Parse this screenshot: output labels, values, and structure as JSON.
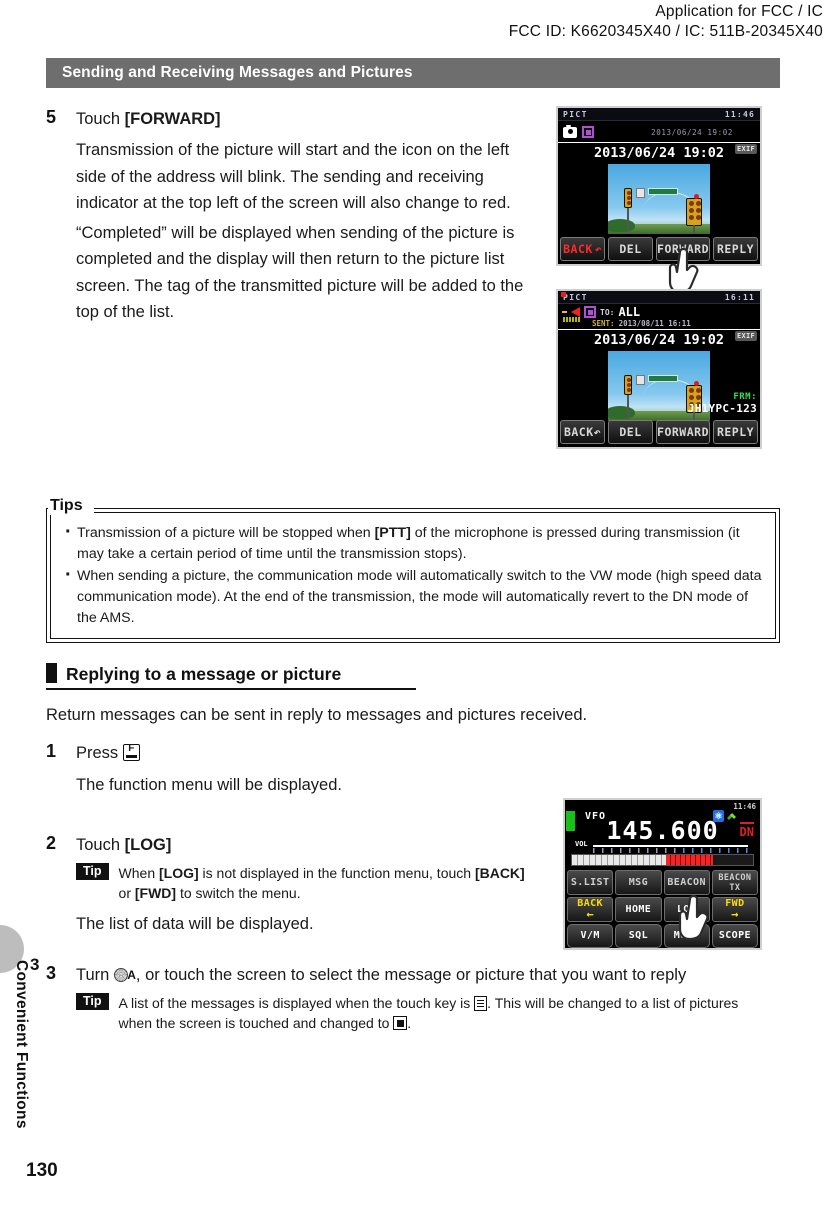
{
  "header": {
    "line1": "Application for FCC / IC",
    "line2": "FCC ID: K6620345X40 / IC: 511B-20345X40"
  },
  "sidebar": {
    "chapter_label": "Convenient Functions",
    "chapter_number": "3",
    "page_number": "130"
  },
  "section_bar": {
    "title": "Sending and Receiving Messages and Pictures"
  },
  "step5": {
    "number": "5",
    "head_prefix": "Touch ",
    "head_key": "[FORWARD]",
    "para1": "Transmission of the picture will start and the icon on the left side of the address will blink. The sending and receiving indicator at the top left of the screen will also change to red.",
    "para2": "“Completed” will be displayed when sending of the picture is completed and the display will then return to the picture list screen. The tag of the transmitted picture will be added to the top of the list."
  },
  "tips_box": {
    "title": "Tips",
    "items": [
      {
        "a": "Transmission of a picture will be stopped when ",
        "b": "[PTT]",
        "c": " of the microphone is pressed during transmission (it may take a certain period of time until the transmission stops)."
      },
      {
        "a": "When sending a picture, the communication mode will automatically switch to the VW mode (high speed data communication mode). At the end of the transmission, the mode will automatically revert to the DN mode of the AMS.",
        "b": "",
        "c": ""
      }
    ]
  },
  "subhead": {
    "title": "Replying to a message or picture"
  },
  "intro": {
    "text": "Return messages can be sent in reply to messages and pictures received."
  },
  "step1": {
    "number": "1",
    "head": "Press",
    "body": "The function menu will be displayed."
  },
  "step2": {
    "number": "2",
    "head_prefix": "Touch ",
    "head_key": "[LOG]",
    "tip_chip": "Tip",
    "tip_a": "When ",
    "tip_key1": "[LOG]",
    "tip_b": " is not displayed in the function menu, touch ",
    "tip_key2": "[BACK]",
    "tip_c": " or ",
    "tip_key3": "[FWD]",
    "tip_d": " to switch the menu.",
    "body": "The list of data will be displayed."
  },
  "step3": {
    "number": "3",
    "head_a": "Turn ",
    "head_b": ", or touch the screen to select the message or picture that you want to reply",
    "tip_chip": "Tip",
    "tip_a": "A list of the messages is displayed when the touch key is ",
    "tip_b": ". This will be changed to a list of pictures when the screen is touched and changed to ",
    "tip_c": "."
  },
  "screen1": {
    "mode_label": "PICT",
    "clock": "11:46",
    "sent_stamp": "2013/06/24 19:02",
    "date_time": "2013/06/24  19:02",
    "exif": "EXIF",
    "keys": [
      "BACK",
      "DEL",
      "FORWARD",
      "REPLY"
    ]
  },
  "screen2": {
    "mode_label": "PICT",
    "clock": "16:11",
    "to_label": "TO:",
    "to_value": "ALL",
    "sent_label": "SENT:",
    "sent_value": "2013/08/11  16:11",
    "date_time": "2013/06/24  19:02",
    "exif": "EXIF",
    "frm_label": "FRM:",
    "frm_value": "JH1YPC-123",
    "keys": [
      "BACK",
      "DEL",
      "FORWARD",
      "REPLY"
    ]
  },
  "screen3": {
    "clock": "11:46",
    "mode": "VFO",
    "frequency": "145.600",
    "data_mode": "DN",
    "vol_label": "VOL",
    "row1": [
      "S.LIST",
      "MSG",
      "BEACON",
      "BEACON TX"
    ],
    "row2": [
      "BACK",
      "HOME",
      "LOG",
      "FWD"
    ],
    "row3": [
      "V/M",
      "SQL",
      "MUTE",
      "SCOPE"
    ]
  },
  "colors": {
    "section_bar": "#6e6e6e",
    "accent_red": "#e02020",
    "accent_yellow": "#ffdd00",
    "accent_green": "#18c018",
    "sidebar_tab": "#bdbdbd"
  }
}
